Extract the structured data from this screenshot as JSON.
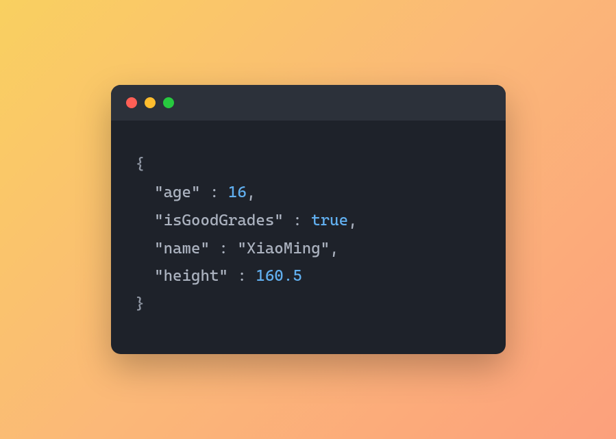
{
  "code": {
    "open": "{",
    "close": "}",
    "lines": [
      {
        "key": "\"age\"",
        "op": " : ",
        "value": "16",
        "type": "number",
        "trail": ","
      },
      {
        "key": "\"isGoodGrades\"",
        "op": " : ",
        "value": "true",
        "type": "boolean",
        "trail": ","
      },
      {
        "key": "\"name\"",
        "op": " : ",
        "value": "\"XiaoMing\"",
        "type": "string",
        "trail": ","
      },
      {
        "key": "\"height\"",
        "op": " : ",
        "value": "160.5",
        "type": "number",
        "trail": ""
      }
    ]
  }
}
